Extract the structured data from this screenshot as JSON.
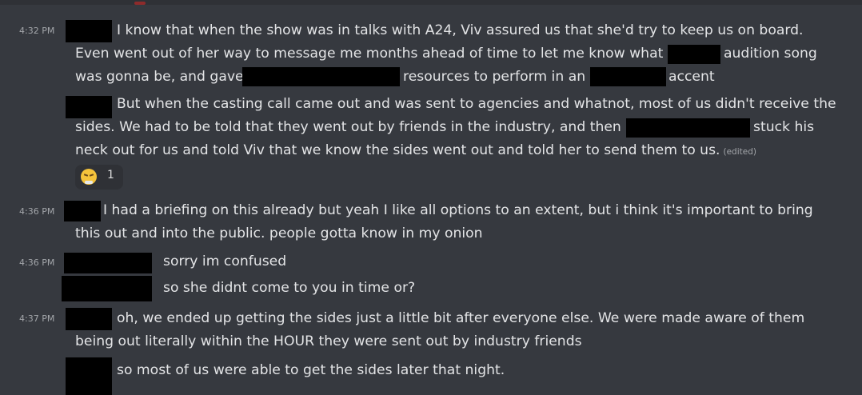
{
  "messages": [
    {
      "timestamp": "4:32 PM",
      "lines": [
        [
          "I know that when the show was in talks with A24, Viv assured us that she'd try to keep us on board."
        ],
        [
          "Even went out of her way to message me months ahead of time to let me know what",
          "audition song"
        ],
        [
          "was gonna be, and gave",
          "resources to perform in an",
          "accent"
        ]
      ]
    },
    {
      "lines": [
        [
          "But when the casting call came out and was sent to agencies and whatnot, most of us didn't receive the"
        ],
        [
          "sides. We had to be told that they went out by friends in the industry, and then",
          "stuck his"
        ],
        [
          "neck out for us and told Viv that we know the sides went out and told her to send them to us."
        ]
      ],
      "edited": "(edited)",
      "reaction": {
        "emoji": "steam-face-icon",
        "count": "1"
      }
    },
    {
      "timestamp": "4:36 PM",
      "lines": [
        [
          "I had a briefing on this already but yeah I like all options to an extent, but i think it's important to bring"
        ],
        [
          "this out and into the public. people gotta know in my onion"
        ]
      ]
    },
    {
      "timestamp": "4:36 PM",
      "lines": [
        [
          "sorry im confused"
        ]
      ]
    },
    {
      "lines": [
        [
          "so she didnt come to you in time or?"
        ]
      ]
    },
    {
      "timestamp": "4:37 PM",
      "lines": [
        [
          "oh, we ended up getting the sides just a little bit after everyone else. We were made aware of them"
        ],
        [
          "being out literally within the HOUR they were sent out by industry friends"
        ]
      ]
    },
    {
      "lines": [
        [
          "so most of us were able to get the sides later that night."
        ]
      ]
    }
  ]
}
